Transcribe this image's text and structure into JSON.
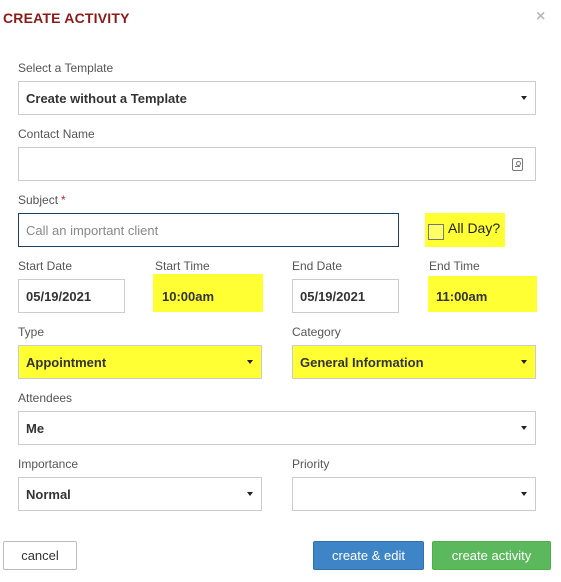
{
  "dialog": {
    "title": "CREATE ACTIVITY",
    "close_glyph": "×"
  },
  "template": {
    "label": "Select a Template",
    "value": "Create without a Template"
  },
  "contact": {
    "label": "Contact Name",
    "value": ""
  },
  "subject": {
    "label": "Subject",
    "required_mark": "*",
    "placeholder": "Call an important client"
  },
  "all_day": {
    "label": "All Day?",
    "checked": false
  },
  "start_date": {
    "label": "Start Date",
    "value": "05/19/2021"
  },
  "start_time": {
    "label": "Start Time",
    "value": "10:00am"
  },
  "end_date": {
    "label": "End Date",
    "value": "05/19/2021"
  },
  "end_time": {
    "label": "End Time",
    "value": "11:00am"
  },
  "type": {
    "label": "Type",
    "value": "Appointment"
  },
  "category": {
    "label": "Category",
    "value": "General Information"
  },
  "attendees": {
    "label": "Attendees",
    "value": "Me"
  },
  "importance": {
    "label": "Importance",
    "value": "Normal"
  },
  "priority": {
    "label": "Priority",
    "value": ""
  },
  "buttons": {
    "cancel": "cancel",
    "create_edit": "create & edit",
    "create": "create activity"
  },
  "colors": {
    "title": "#8b1a1a",
    "highlight": "#ffff33",
    "primary": "#3d85c6",
    "success": "#5cb85c"
  },
  "icons": {
    "close": "close-icon",
    "contact_card": "contact-card-icon",
    "dropdown": "chevron-down-icon"
  }
}
